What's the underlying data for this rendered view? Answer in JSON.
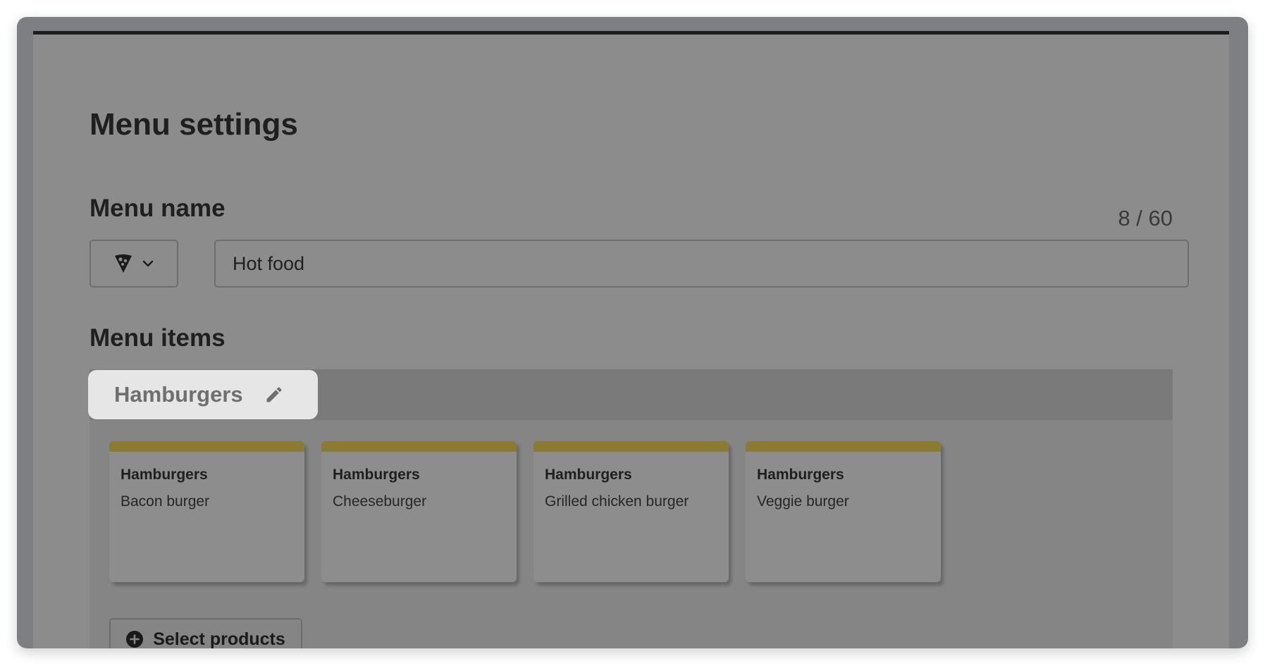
{
  "page": {
    "title": "Menu settings"
  },
  "menu_name": {
    "heading": "Menu name",
    "counter": "8 / 60",
    "icon_selector": {
      "icon": "pizza-slice-icon",
      "chevron": "chevron-down-icon"
    },
    "input": {
      "value": "Hot food"
    }
  },
  "menu_items": {
    "heading": "Menu items",
    "category": {
      "label": "Hamburgers",
      "edit_icon": "pencil-icon"
    },
    "cards": [
      {
        "category": "Hamburgers",
        "product": "Bacon burger"
      },
      {
        "category": "Hamburgers",
        "product": "Cheeseburger"
      },
      {
        "category": "Hamburgers",
        "product": "Grilled chicken burger"
      },
      {
        "category": "Hamburgers",
        "product": "Veggie burger"
      }
    ],
    "select_products": {
      "label": "Select products",
      "icon": "plus-circle-icon"
    }
  },
  "colors": {
    "overlay": "#8c8c8c",
    "card_accent": "#8a7a33",
    "category_pill": "#e6e6e6",
    "text_dark": "#1f1f1f"
  }
}
